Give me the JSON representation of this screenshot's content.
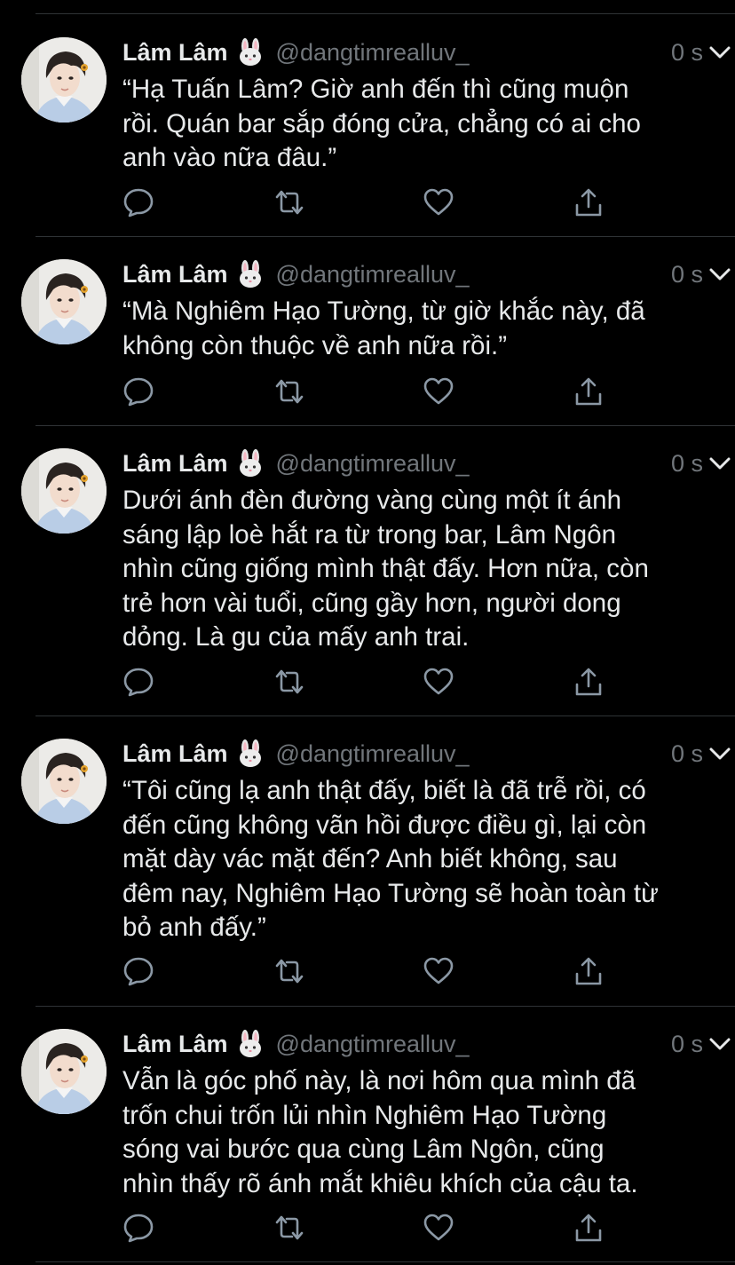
{
  "tweets": [
    {
      "name": "Lâm Lâm",
      "emoji": "rabbit-face",
      "handle": "@dangtimrealluv_",
      "time": "0 s",
      "text": "“Hạ Tuấn Lâm? Giờ anh đến thì cũng muộn\nrồi. Quán bar sắp đóng cửa, chẳng có ai cho\nanh vào nữa đâu.”"
    },
    {
      "name": "Lâm Lâm",
      "emoji": "rabbit-face",
      "handle": "@dangtimrealluv_",
      "time": "0 s",
      "text": "“Mà Nghiêm Hạo Tường, từ giờ khắc này, đã\nkhông còn thuộc về anh nữa rồi.”"
    },
    {
      "name": "Lâm Lâm",
      "emoji": "rabbit-face",
      "handle": "@dangtimrealluv_",
      "time": "0 s",
      "text": "Dưới ánh đèn đường vàng cùng một ít ánh\nsáng lập loè hắt ra từ trong bar, Lâm Ngôn\nnhìn cũng giống mình thật đấy. Hơn nữa, còn\ntrẻ hơn vài tuổi, cũng gầy hơn, người dong\ndỏng. Là gu của mấy anh trai."
    },
    {
      "name": "Lâm Lâm",
      "emoji": "rabbit-face",
      "handle": "@dangtimrealluv_",
      "time": "0 s",
      "text": "“Tôi cũng lạ anh thật đấy, biết là đã trễ rồi, có\nđến cũng không vãn hồi được điều gì, lại còn\nmặt dày vác mặt đến? Anh biết không, sau\nđêm nay, Nghiêm Hạo Tường sẽ hoàn toàn từ\nbỏ anh đấy.”"
    },
    {
      "name": "Lâm Lâm",
      "emoji": "rabbit-face",
      "handle": "@dangtimrealluv_",
      "time": "0 s",
      "text": "Vẫn là góc phố này, là nơi hôm qua mình đã\ntrốn chui trốn lủi nhìn Nghiêm Hạo Tường\nsóng vai bước qua cùng Lâm Ngôn, cũng\nnhìn thấy rõ ánh mắt khiêu khích của cậu ta."
    }
  ],
  "icons": {
    "reply": "reply-icon",
    "retweet": "retweet-icon",
    "like": "heart-icon",
    "share": "share-icon",
    "more": "chevron-down-icon"
  },
  "colors": {
    "background": "#000000",
    "text": "#e7e9ea",
    "secondary": "#71767b",
    "divider": "#2f3336"
  }
}
